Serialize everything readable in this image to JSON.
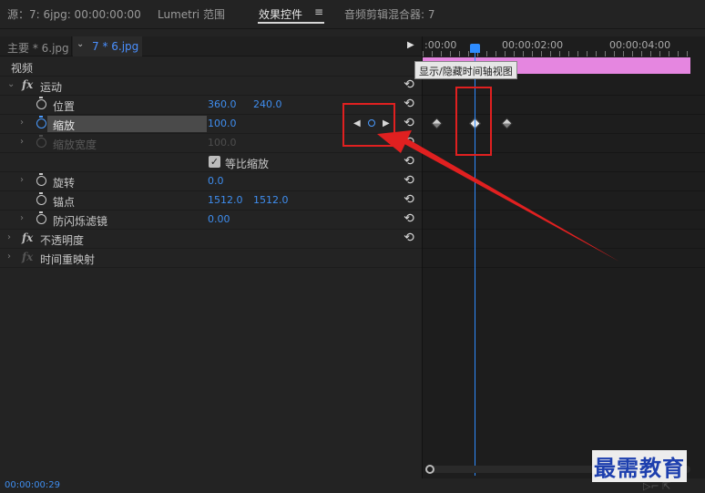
{
  "tabs": {
    "source": "源：7: 6jpg: 00:00:00:00",
    "lumetri": "Lumetri 范围",
    "effects": "效果控件",
    "menu_icon": "≡",
    "audio_mixer": "音频剪辑混合器: 7"
  },
  "sequence": {
    "main": "主要 * 6.jpg",
    "clip": "7 * 6.jpg"
  },
  "rows": {
    "video": "视频",
    "motion": "运动",
    "position": {
      "label": "位置",
      "x": "360.0",
      "y": "240.0"
    },
    "scale": {
      "label": "缩放",
      "value": "100.0"
    },
    "scale_width": {
      "label": "缩放宽度",
      "value": "100.0"
    },
    "uniform_scale": {
      "label": "等比缩放",
      "checked": true
    },
    "rotation": {
      "label": "旋转",
      "value": "0.0"
    },
    "anchor": {
      "label": "锚点",
      "x": "1512.0",
      "y": "1512.0"
    },
    "antiflicker": {
      "label": "防闪烁滤镜",
      "value": "0.00"
    },
    "opacity": "不透明度",
    "time_remap": "时间重映射"
  },
  "fx_label": "fx",
  "timeline": {
    "ruler": [
      ":00:00",
      "00:00:02:00",
      "00:00:04:00"
    ],
    "tooltip": "显示/隐藏时间轴视图"
  },
  "timecode": "00:00:00:29",
  "watermark": "最需教育",
  "colors": {
    "accent": "#3f8ef0",
    "clip_bar": "#e586e0",
    "highlight": "#e02020"
  }
}
